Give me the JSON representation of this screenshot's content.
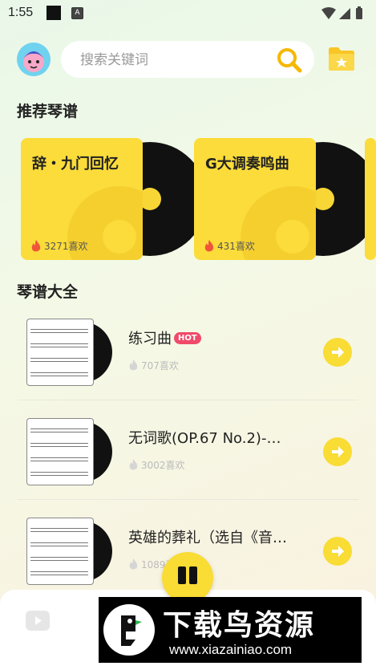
{
  "status_bar": {
    "time": "1:55",
    "notif_letter": "A"
  },
  "header": {
    "search_placeholder": "搜索关键词"
  },
  "sections": {
    "recommend_title": "推荐琴谱",
    "all_title": "琴谱大全"
  },
  "recommend": [
    {
      "title": "辞・九门回忆",
      "likes": "3271喜欢"
    },
    {
      "title": "G大调奏鸣曲",
      "likes": "431喜欢"
    }
  ],
  "songs": [
    {
      "title": "练习曲",
      "badge": "HOT",
      "likes": "707喜欢"
    },
    {
      "title": "无词歌(OP.67 No.2)-…",
      "badge": "",
      "likes": "3002喜欢"
    },
    {
      "title": "英雄的葬礼（选自《音…",
      "badge": "",
      "likes": "1089喜欢"
    }
  ],
  "watermark": {
    "title": "下载鸟资源",
    "url": "www.xiazainiao.com"
  },
  "colors": {
    "accent": "#f9dc34",
    "hot": "#f04a6a",
    "flame": "#f0553a"
  }
}
